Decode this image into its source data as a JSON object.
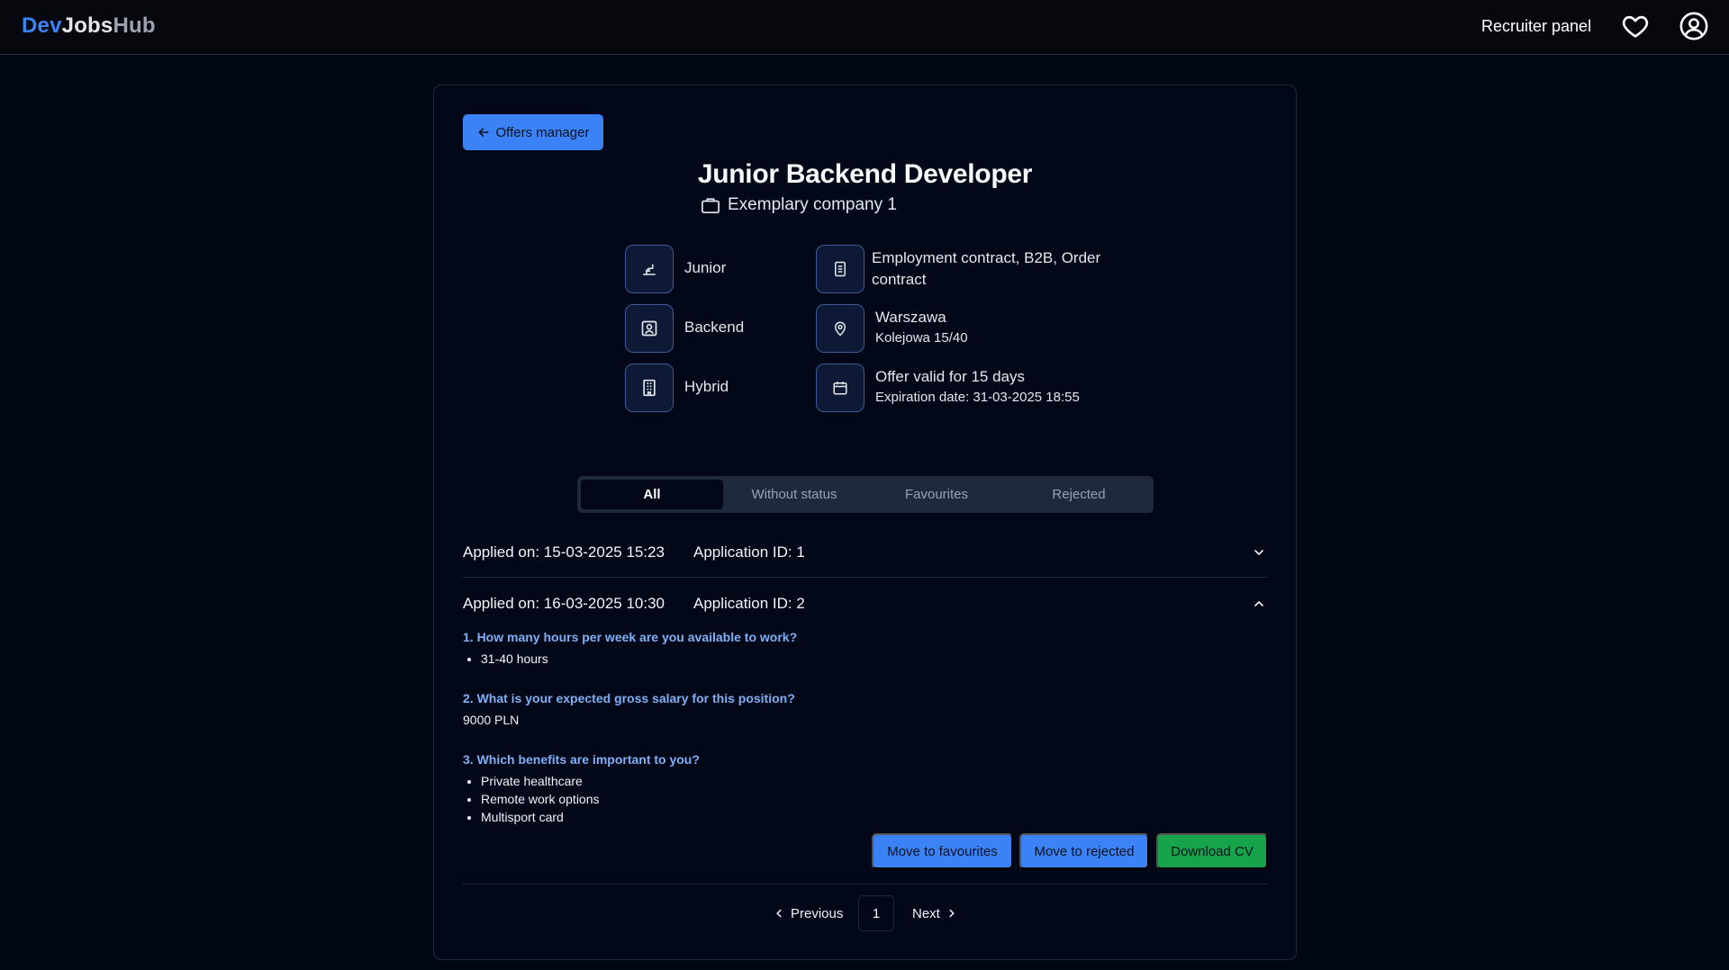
{
  "header": {
    "logo": {
      "part1": "Dev",
      "part2": "Jobs",
      "part3": "Hub"
    },
    "recruiter_panel": "Recruiter panel",
    "icons": [
      "heart-icon",
      "user-circle-icon"
    ]
  },
  "offer": {
    "back_label": "Offers manager",
    "title": "Junior Backend Developer",
    "company": "Exemplary company 1",
    "details": {
      "level": "Junior",
      "category": "Backend",
      "work_mode": "Hybrid",
      "contract": "Employment contract, B2B, Order contract",
      "city": "Warszawa",
      "address": "Kolejowa 15/40",
      "validity": "Offer valid for 15 days",
      "expiration": "Expiration date: 31-03-2025 18:55"
    }
  },
  "tabs": [
    {
      "label": "All",
      "active": true
    },
    {
      "label": "Without status",
      "active": false
    },
    {
      "label": "Favourites",
      "active": false
    },
    {
      "label": "Rejected",
      "active": false
    }
  ],
  "applications": [
    {
      "applied": "Applied on: 15-03-2025 15:23",
      "app_id": "Application ID: 1",
      "expanded": false
    },
    {
      "applied": "Applied on: 16-03-2025 10:30",
      "app_id": "Application ID: 2",
      "expanded": true,
      "questions": [
        {
          "q": "1. How many hours per week are you available to work?",
          "answers": [
            "31-40 hours"
          ]
        },
        {
          "q": "2. What is your expected gross salary for this position?",
          "answer_text": "9000 PLN"
        },
        {
          "q": "3. Which benefits are important to you?",
          "answers": [
            "Private healthcare",
            "Remote work options",
            "Multisport card"
          ]
        }
      ],
      "actions": {
        "favourite": "Move to favourites",
        "reject": "Move to rejected",
        "download": "Download CV"
      }
    }
  ],
  "pagination": {
    "previous": "Previous",
    "current": "1",
    "next": "Next"
  },
  "colors": {
    "accent": "#3b82f6",
    "success": "#16a34a",
    "question": "#7fb0f7",
    "background": "#000814"
  }
}
